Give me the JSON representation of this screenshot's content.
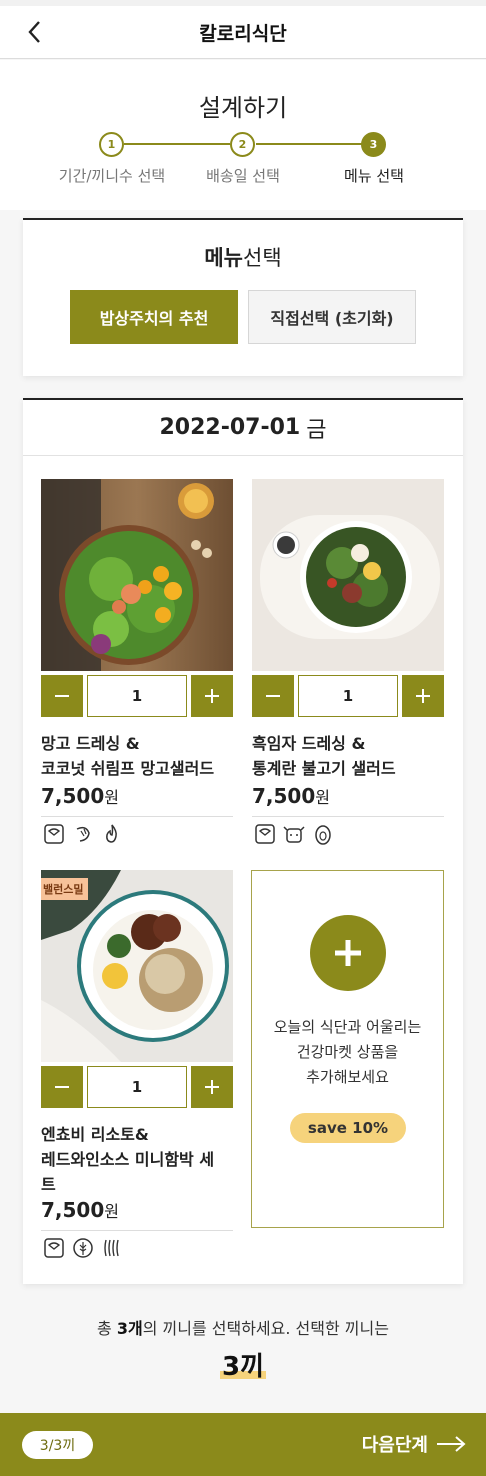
{
  "header": {
    "title": "칼로리식단"
  },
  "design": {
    "title": "설계하기",
    "steps": [
      {
        "num": "1",
        "label": "기간/끼니수 선택"
      },
      {
        "num": "2",
        "label": "배송일 선택"
      },
      {
        "num": "3",
        "label": "메뉴 선택"
      }
    ]
  },
  "menu_select": {
    "title_bold": "메뉴",
    "title_rest": "선택",
    "recommend_label": "밥상주치의 추천",
    "direct_label": "직접선택 (초기화)"
  },
  "day": {
    "date": "2022-07-01",
    "weekday": "금",
    "items": [
      {
        "name_line1": "망고 드레싱 &",
        "name_line2": "코코넛 쉬림프 망고샐러드",
        "price": "7,500",
        "currency": "원",
        "qty": "1",
        "icons": [
          "scale-icon",
          "shrimp-icon",
          "fire-icon"
        ]
      },
      {
        "name_line1": "흑임자 드레싱 &",
        "name_line2": "통계란 불고기 샐러드",
        "price": "7,500",
        "currency": "원",
        "qty": "1",
        "icons": [
          "scale-icon",
          "cow-icon",
          "egg-icon"
        ]
      },
      {
        "badge": "밸런스밀",
        "name_line1": "엔쵸비 리소토&",
        "name_line2": "레드와인소스 미니함박 세",
        "name_line3": "트",
        "price": "7,500",
        "currency": "원",
        "qty": "1",
        "icons": [
          "scale-icon",
          "grain-icon",
          "wheat-icon"
        ]
      }
    ],
    "add_box": {
      "line1": "오늘의 식단과 어울리는",
      "line2": "건강마켓 상품을",
      "line3": "추가해보세요",
      "save": "save 10%"
    }
  },
  "summary": {
    "pre": "총 ",
    "count": "3개",
    "post": "의 끼니를 선택하세요. 선택한 끼니는",
    "total": "3끼"
  },
  "footer": {
    "count": "3/3끼",
    "next": "다음단계"
  },
  "colors": {
    "accent": "#8b8a1b",
    "highlight": "#f6d37c"
  }
}
